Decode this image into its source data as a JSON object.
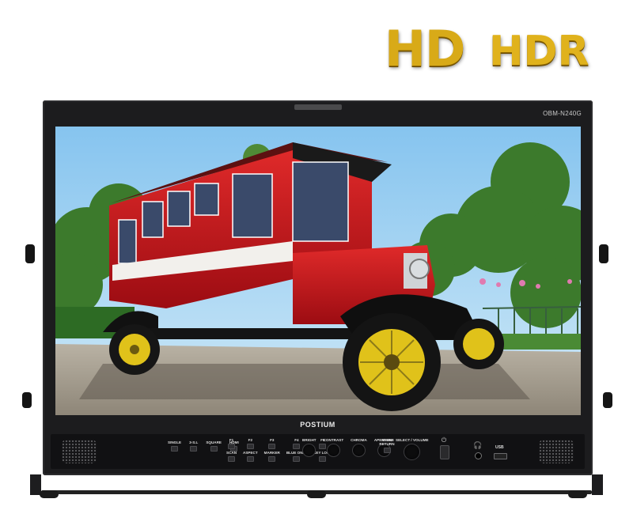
{
  "badge": {
    "hd": "HD",
    "hdr": "HDR"
  },
  "monitor": {
    "model": "OBM-N240G",
    "brand": "POSTIUM"
  },
  "controls": {
    "left_buttons": [
      {
        "label": "SINGLE"
      },
      {
        "label": "3-S.L"
      },
      {
        "label": "SQUARE"
      },
      {
        "label": "HDMI"
      }
    ],
    "function_buttons": [
      {
        "label": "F1",
        "sub": "SCAN"
      },
      {
        "label": "F2",
        "sub": "ASPECT"
      },
      {
        "label": "F3",
        "sub": "MARKER"
      },
      {
        "label": "F4",
        "sub": "BLUE ONLY"
      },
      {
        "label": "F5",
        "sub": "KEY LOCK"
      }
    ],
    "knobs": [
      {
        "label": "BRIGHT"
      },
      {
        "label": "CONTRAST"
      },
      {
        "label": "CHROMA"
      },
      {
        "label": "APERTURE"
      }
    ],
    "menu_label": "MENU RETURN",
    "select_label": "SELECT / VOLUME",
    "usb_label": "USB"
  },
  "colors": {
    "badge_gold": "#d8aa18",
    "bezel": "#1c1c1e",
    "truck_red": "#c8141c",
    "wheel_yellow": "#e0c21a"
  }
}
